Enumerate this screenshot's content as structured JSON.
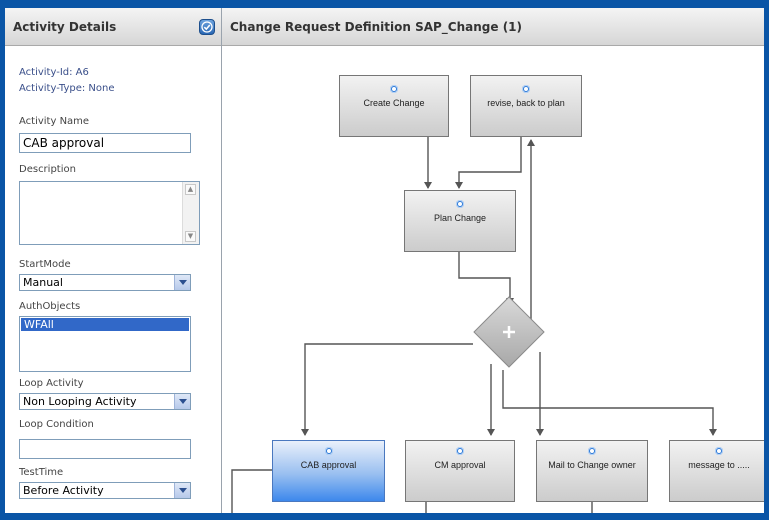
{
  "left_panel": {
    "title": "Activity Details",
    "activity_id": "Activity-Id: A6",
    "activity_type": "Activity-Type: None",
    "activity_name_label": "Activity Name",
    "activity_name_value": "CAB approval",
    "description_label": "Description",
    "description_value": "",
    "start_mode_label": "StartMode",
    "start_mode_value": "Manual",
    "auth_objects_label": "AuthObjects",
    "auth_objects_items": [
      "WFAll"
    ],
    "loop_activity_label": "Loop Activity",
    "loop_activity_value": "Non Looping Activity",
    "loop_condition_label": "Loop Condition",
    "loop_condition_value": "",
    "test_time_label": "TestTime",
    "test_time_value": "Before Activity"
  },
  "right_panel": {
    "title": "Change Request Definition SAP_Change (1)"
  },
  "diagram": {
    "nodes": [
      {
        "id": "create_change",
        "label": "Create Change",
        "selected": false
      },
      {
        "id": "revise",
        "label": "revise, back to plan",
        "selected": false
      },
      {
        "id": "plan_change",
        "label": "Plan Change",
        "selected": false
      },
      {
        "id": "cab_approval",
        "label": "CAB approval",
        "selected": true
      },
      {
        "id": "cm_approval",
        "label": "CM approval",
        "selected": false
      },
      {
        "id": "mail_owner",
        "label": "Mail to Change owner",
        "selected": false
      },
      {
        "id": "message_to",
        "label": "message to .....",
        "selected": false
      }
    ],
    "gateway_symbol": "+"
  },
  "colors": {
    "window_border": "#0a55a6",
    "selected_node": "#3d88ec",
    "gateway": "#b5b5b5"
  }
}
